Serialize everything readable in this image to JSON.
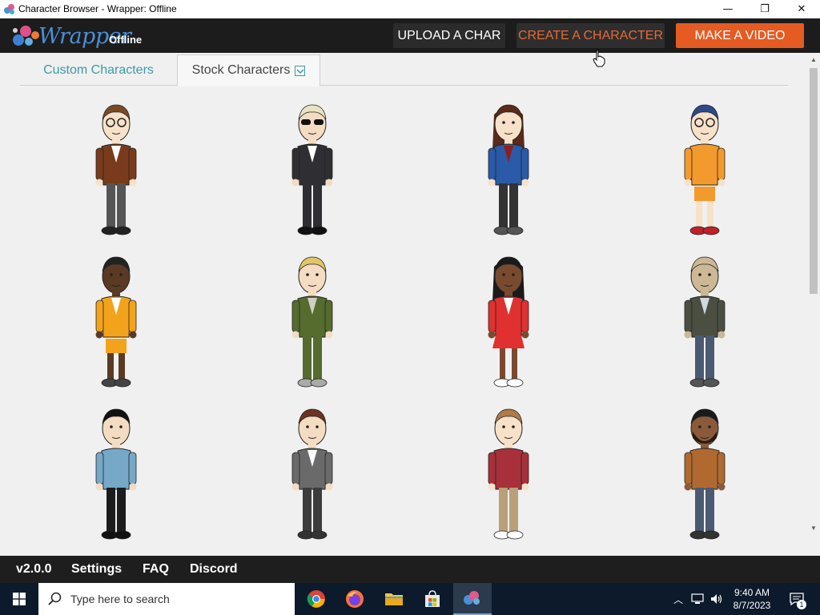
{
  "window": {
    "title": "Character Browser - Wrapper: Offline",
    "minimize_glyph": "—",
    "restore_glyph": "❐",
    "close_glyph": "✕"
  },
  "header": {
    "logo_word": "Wrapper",
    "logo_suffix": "Offline",
    "upload_label": "UPLOAD A CHAR",
    "create_label": "CREATE A CHARACTER",
    "video_label": "MAKE A VIDEO"
  },
  "tabs": [
    {
      "label": "Custom Characters"
    },
    {
      "label": "Stock Characters"
    }
  ],
  "characters": [
    {
      "name": "nerd-brown-jacket"
    },
    {
      "name": "agent-black-suit"
    },
    {
      "name": "woman-blue-jacket"
    },
    {
      "name": "basketball-headband"
    },
    {
      "name": "basketball-yellow"
    },
    {
      "name": "soldier-camo"
    },
    {
      "name": "cheerleader"
    },
    {
      "name": "zombie"
    },
    {
      "name": "spock-like"
    },
    {
      "name": "disheveled-man"
    },
    {
      "name": "man-red-hoodie"
    },
    {
      "name": "bearded-overalls"
    }
  ],
  "footer": {
    "version": "v2.0.0",
    "settings": "Settings",
    "faq": "FAQ",
    "discord": "Discord"
  },
  "taskbar": {
    "search_placeholder": "Type here to search",
    "time": "9:40 AM",
    "date": "8/7/2023",
    "notification_count": "1"
  },
  "colors": {
    "accent_orange": "#e55b22",
    "tab_teal": "#3f9aa6",
    "header_bg": "#1c1c1c"
  }
}
